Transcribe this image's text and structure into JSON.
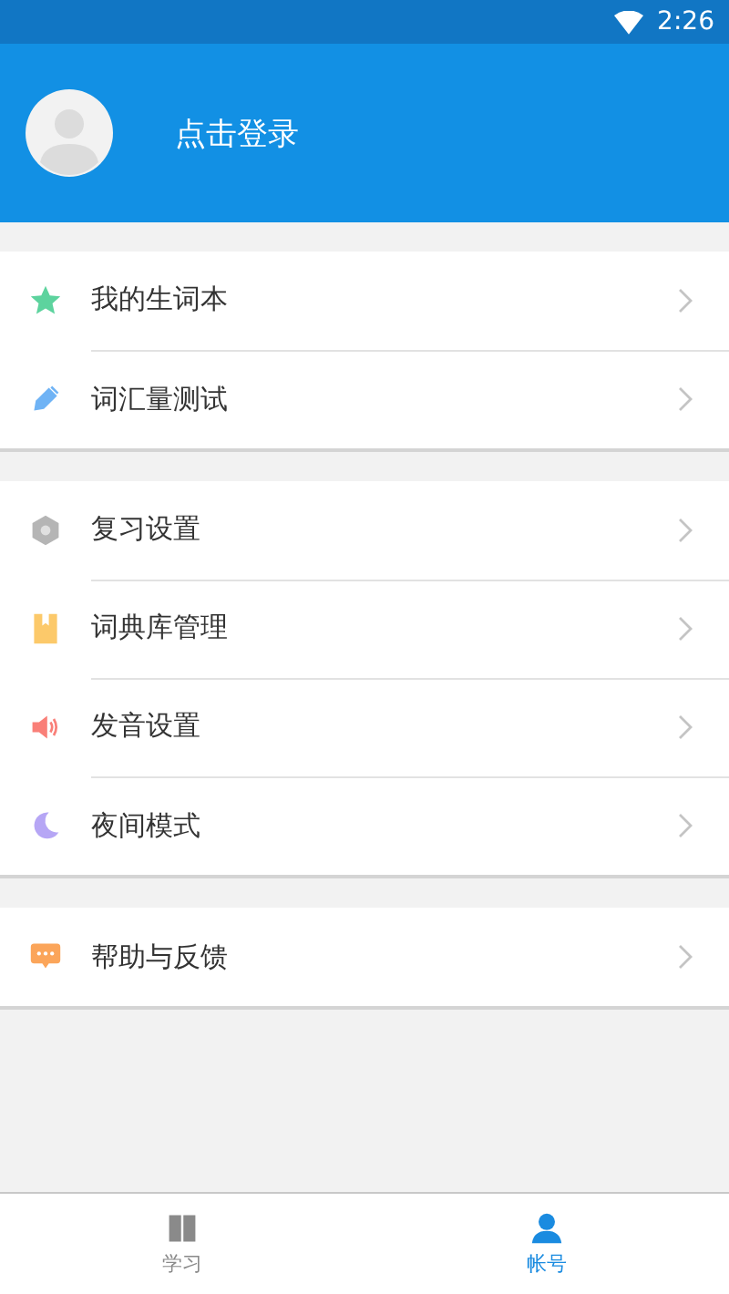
{
  "status_bar": {
    "time": "2:26"
  },
  "header": {
    "login_label": "点击登录"
  },
  "menu_groups": [
    {
      "items": [
        {
          "label": "我的生词本",
          "kind": "star"
        },
        {
          "label": "词汇量测试",
          "kind": "pen"
        }
      ]
    },
    {
      "items": [
        {
          "label": "复习设置",
          "kind": "gear"
        },
        {
          "label": "词典库管理",
          "kind": "bookmark"
        },
        {
          "label": "发音设置",
          "kind": "speaker"
        },
        {
          "label": "夜间模式",
          "kind": "moon"
        }
      ]
    },
    {
      "items": [
        {
          "label": "帮助与反馈",
          "kind": "chat"
        }
      ]
    }
  ],
  "tab_bar": [
    {
      "label": "学习",
      "kind": "book",
      "selected": false
    },
    {
      "label": "帐号",
      "kind": "person",
      "selected": true
    }
  ]
}
